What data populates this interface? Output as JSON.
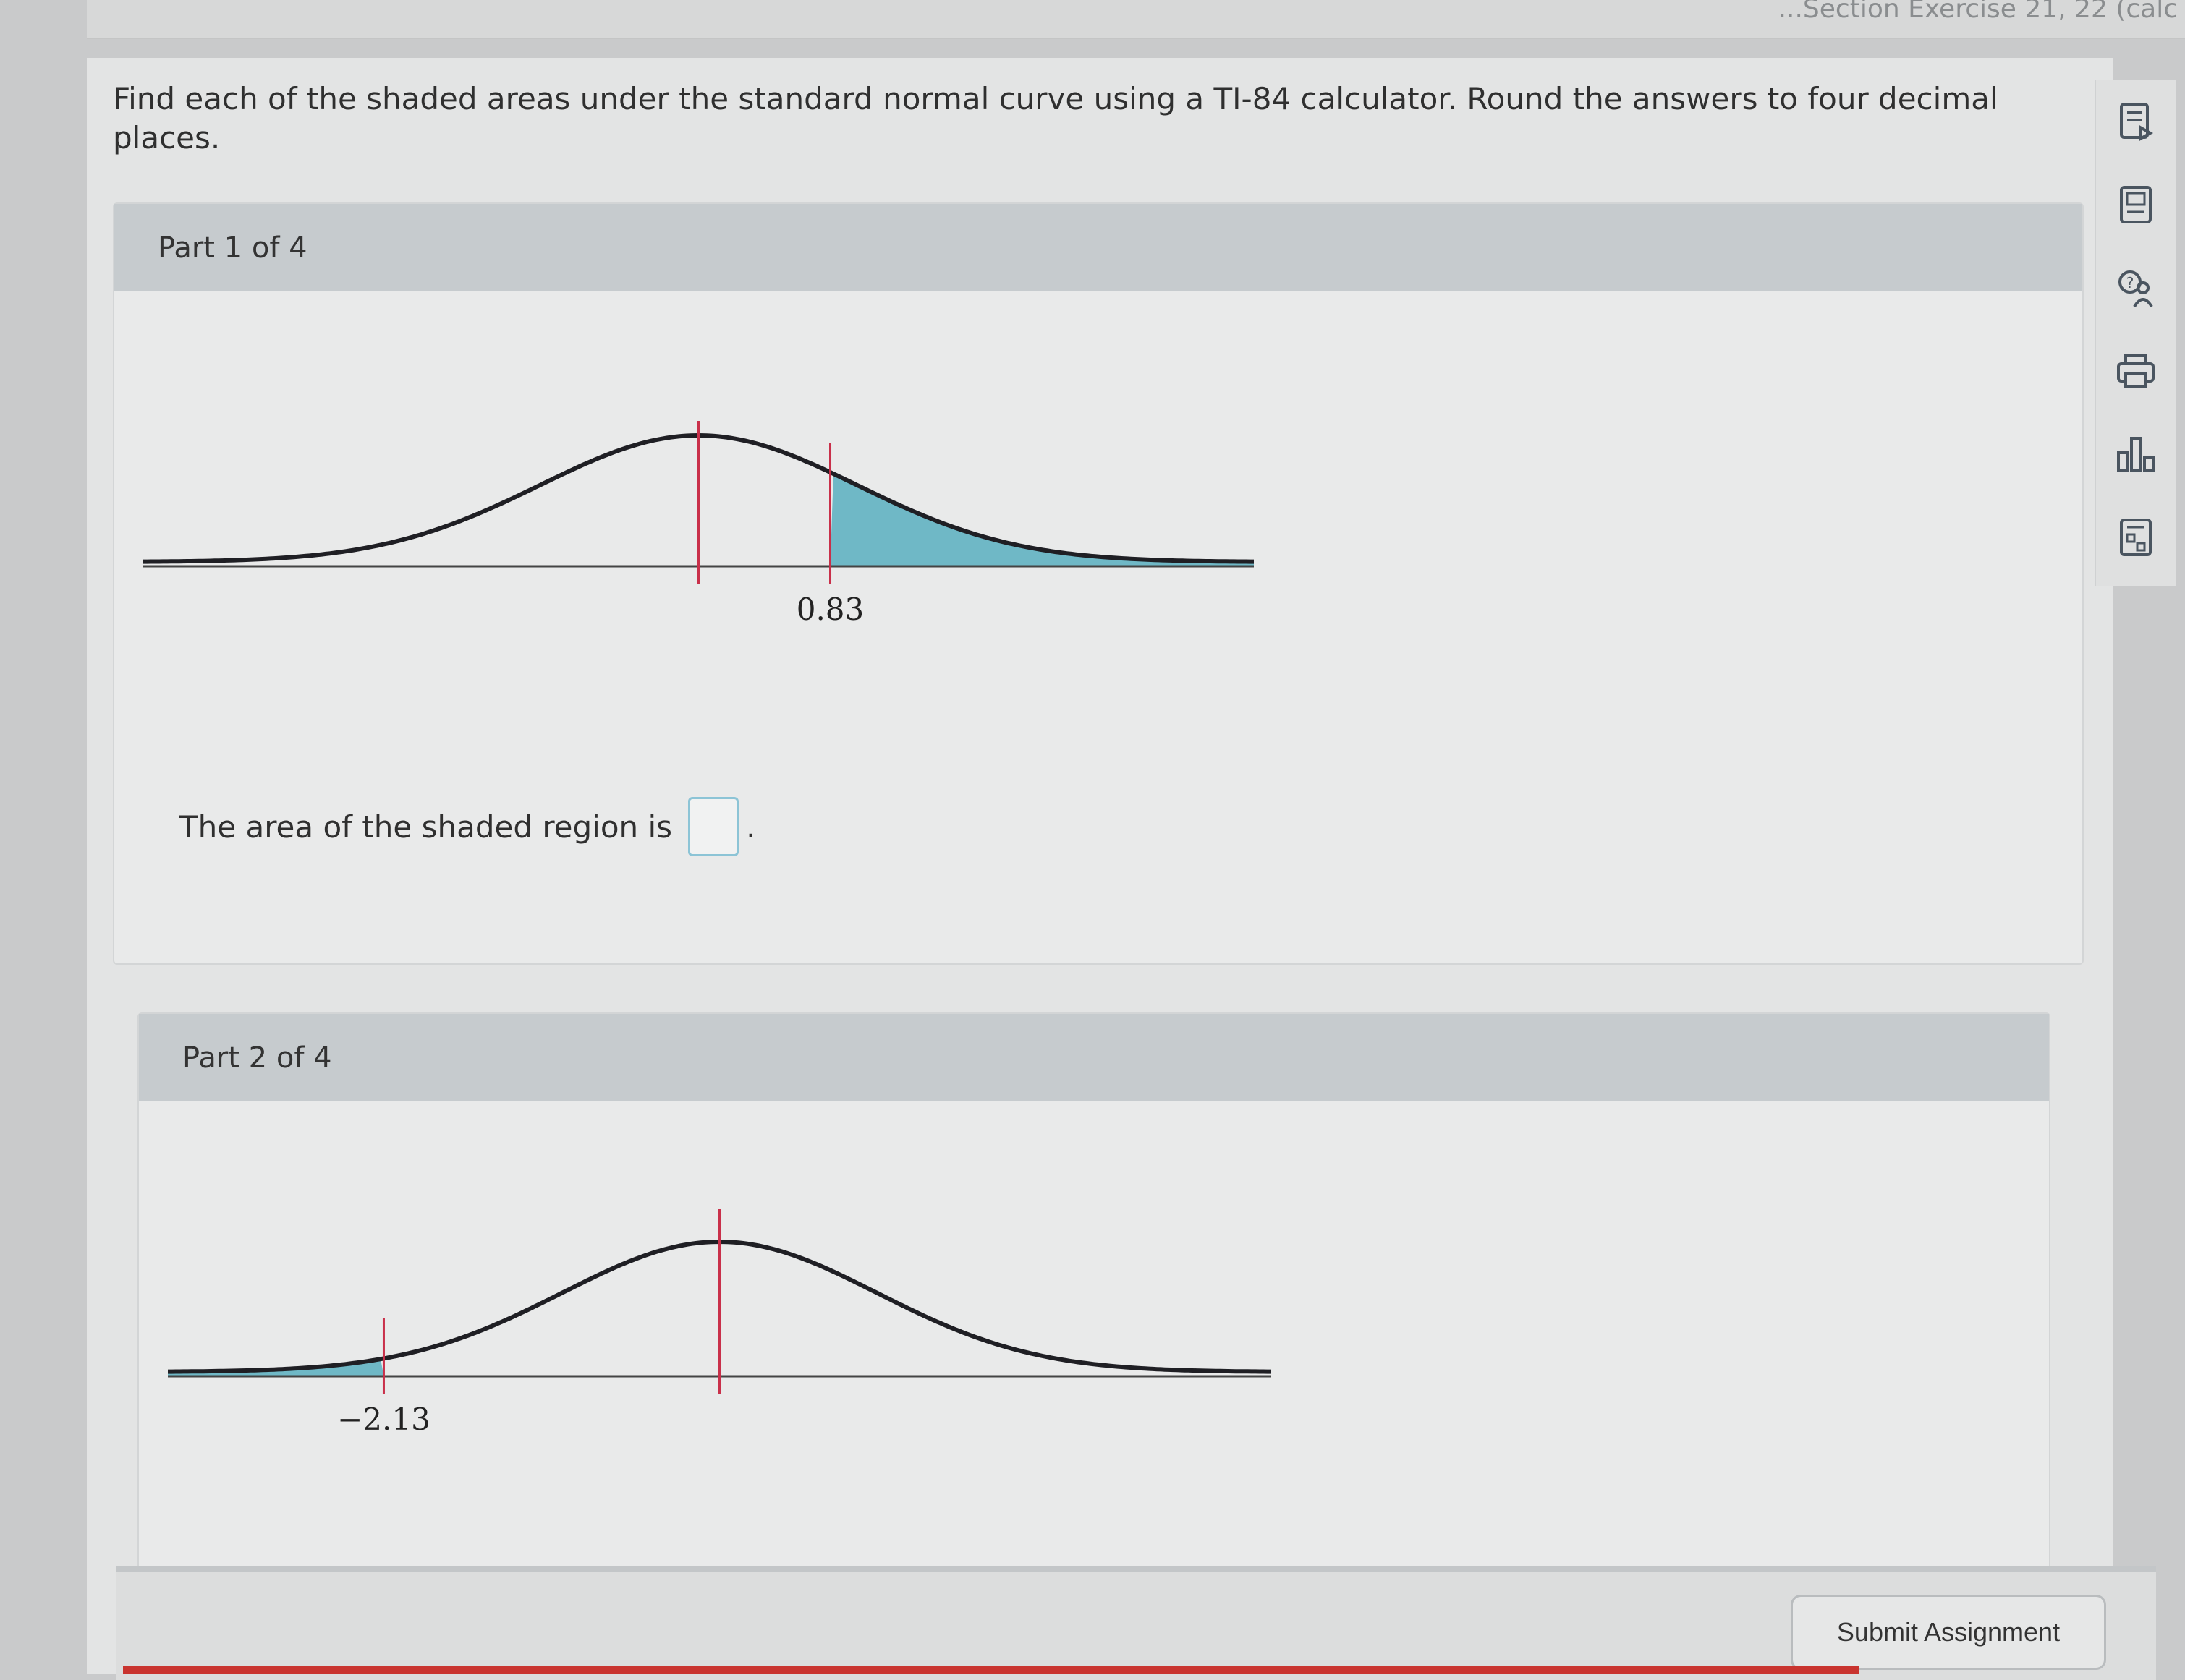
{
  "header": {
    "crumb": "...Section Exercise 21, 22 (calc"
  },
  "instructions": "Find each of the shaded areas under the standard normal curve using a TI-84 calculator. Round the answers to four decimal places.",
  "parts": [
    {
      "title": "Part 1 of 4",
      "z_label": "0.83",
      "z_value": 0.83,
      "shaded_side": "right",
      "answer_prompt": "The area of the shaded region is",
      "answer_value": "",
      "answer_suffix": "."
    },
    {
      "title": "Part 2 of 4",
      "z_label": "−2.13",
      "z_value": -2.13,
      "shaded_side": "left"
    }
  ],
  "toolbar": {
    "icons": [
      "ebook-icon",
      "calculator-icon",
      "help-icon",
      "print-icon",
      "data-chart-icon",
      "formula-sheet-icon"
    ]
  },
  "footer": {
    "submit_label": "Submit Assignment"
  },
  "colors": {
    "shade": "#6fb8c6",
    "center_line": "#c9304a",
    "curve": "#1f1f24"
  }
}
